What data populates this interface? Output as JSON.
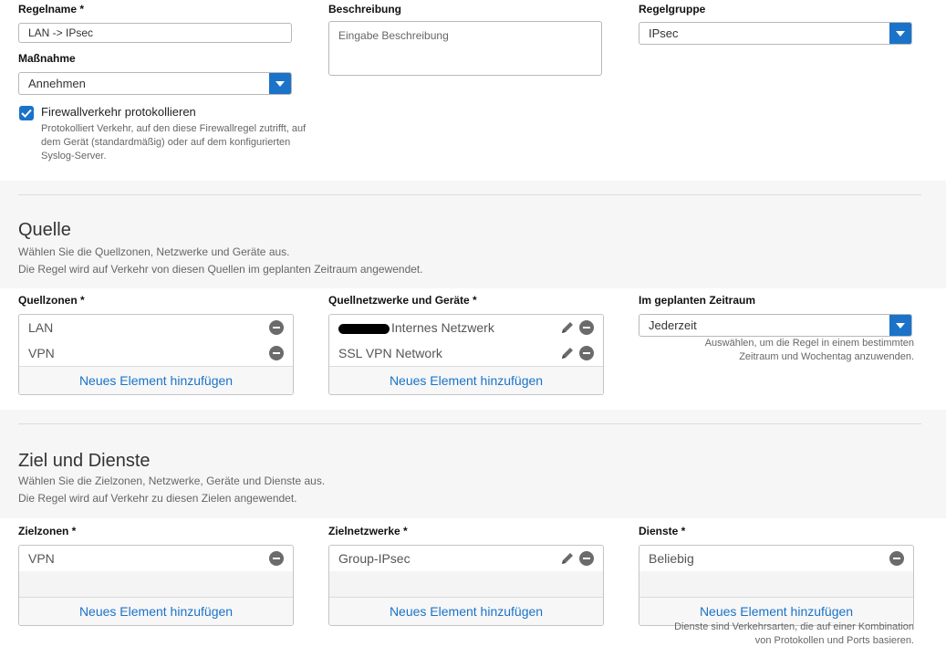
{
  "rule": {
    "name_label": "Regelname *",
    "name_value": "LAN -> IPsec",
    "description_label": "Beschreibung",
    "description_placeholder": "Eingabe Beschreibung",
    "group_label": "Regelgruppe",
    "group_value": "IPsec",
    "action_label": "Maßnahme",
    "action_value": "Annehmen",
    "log_label": "Firewallverkehr protokollieren",
    "log_checked": true,
    "log_hint": "Protokolliert Verkehr, auf den diese Firewallregel zutrifft, auf dem Gerät (standardmäßig) oder auf dem konfigurierten Syslog-Server."
  },
  "source": {
    "title": "Quelle",
    "desc_line1": "Wählen Sie die Quellzonen, Netzwerke und Geräte aus.",
    "desc_line2": "Die Regel wird auf Verkehr von diesen Quellen im geplanten Zeitraum angewendet.",
    "zones_label": "Quellzonen *",
    "zones": [
      "LAN",
      "VPN"
    ],
    "networks_label": "Quellnetzwerke und Geräte *",
    "networks": [
      "Internes Netzwerk",
      "SSL VPN Network"
    ],
    "schedule_label": "Im geplanten Zeitraum",
    "schedule_value": "Jederzeit",
    "schedule_hint": "Auswählen, um die Regel in einem bestimmten Zeitraum und Wochentag anzuwenden."
  },
  "destination": {
    "title": "Ziel und Dienste",
    "desc_line1": "Wählen Sie die Zielzonen, Netzwerke, Geräte und Dienste aus.",
    "desc_line2": "Die Regel wird auf Verkehr zu diesen Zielen angewendet.",
    "zones_label": "Zielzonen *",
    "zones": [
      "VPN"
    ],
    "networks_label": "Zielnetzwerke *",
    "networks": [
      "Group-IPsec"
    ],
    "services_label": "Dienste *",
    "services": [
      "Beliebig"
    ],
    "services_hint": "Dienste sind Verkehrsarten, die auf einer Kombination von Protokollen und Ports basieren."
  },
  "add_element_label": "Neues Element hinzufügen",
  "colors": {
    "accent": "#1a73c8",
    "section_bg": "#f6f6f6"
  }
}
